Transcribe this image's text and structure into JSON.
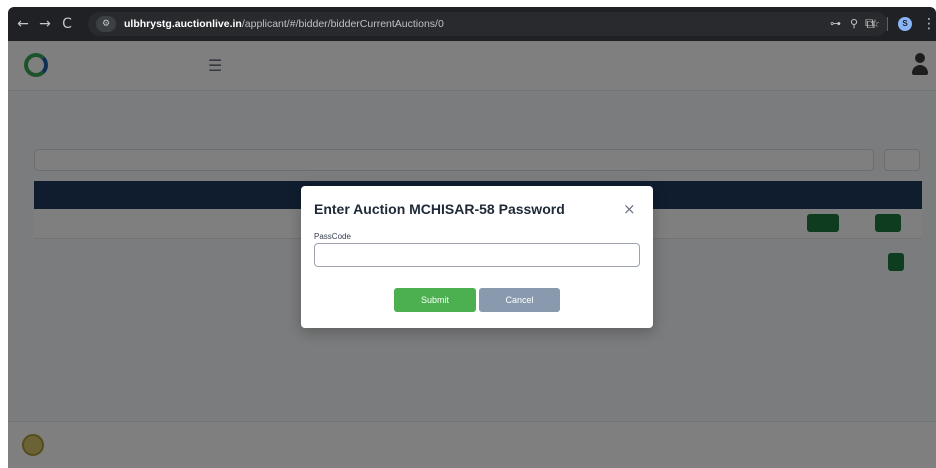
{
  "browser": {
    "url_host": "ulbhrystg.auctionlive.in",
    "url_path": "/applicant/#/bidder/bidderCurrentAuctions/0",
    "back_icon": "←",
    "forward_icon": "→",
    "reload_icon": "C",
    "tune_icon": "⚙",
    "key_icon": "⊶",
    "zoom_icon": "⚲",
    "star_icon": "☆",
    "extensions_icon": "⧉",
    "profile_initial": "S",
    "menu_icon": "⋮"
  },
  "modal": {
    "title": "Enter Auction MCHISAR-58 Password",
    "close_icon": "×",
    "field_label": "PassCode",
    "field_value": "",
    "submit_label": "Submit",
    "cancel_label": "Cancel"
  },
  "colors": {
    "header_bg": "#1e3a5f",
    "accent_green": "#1a7a3c",
    "submit_green": "#4caf50",
    "cancel_gray": "#8a9aae"
  }
}
